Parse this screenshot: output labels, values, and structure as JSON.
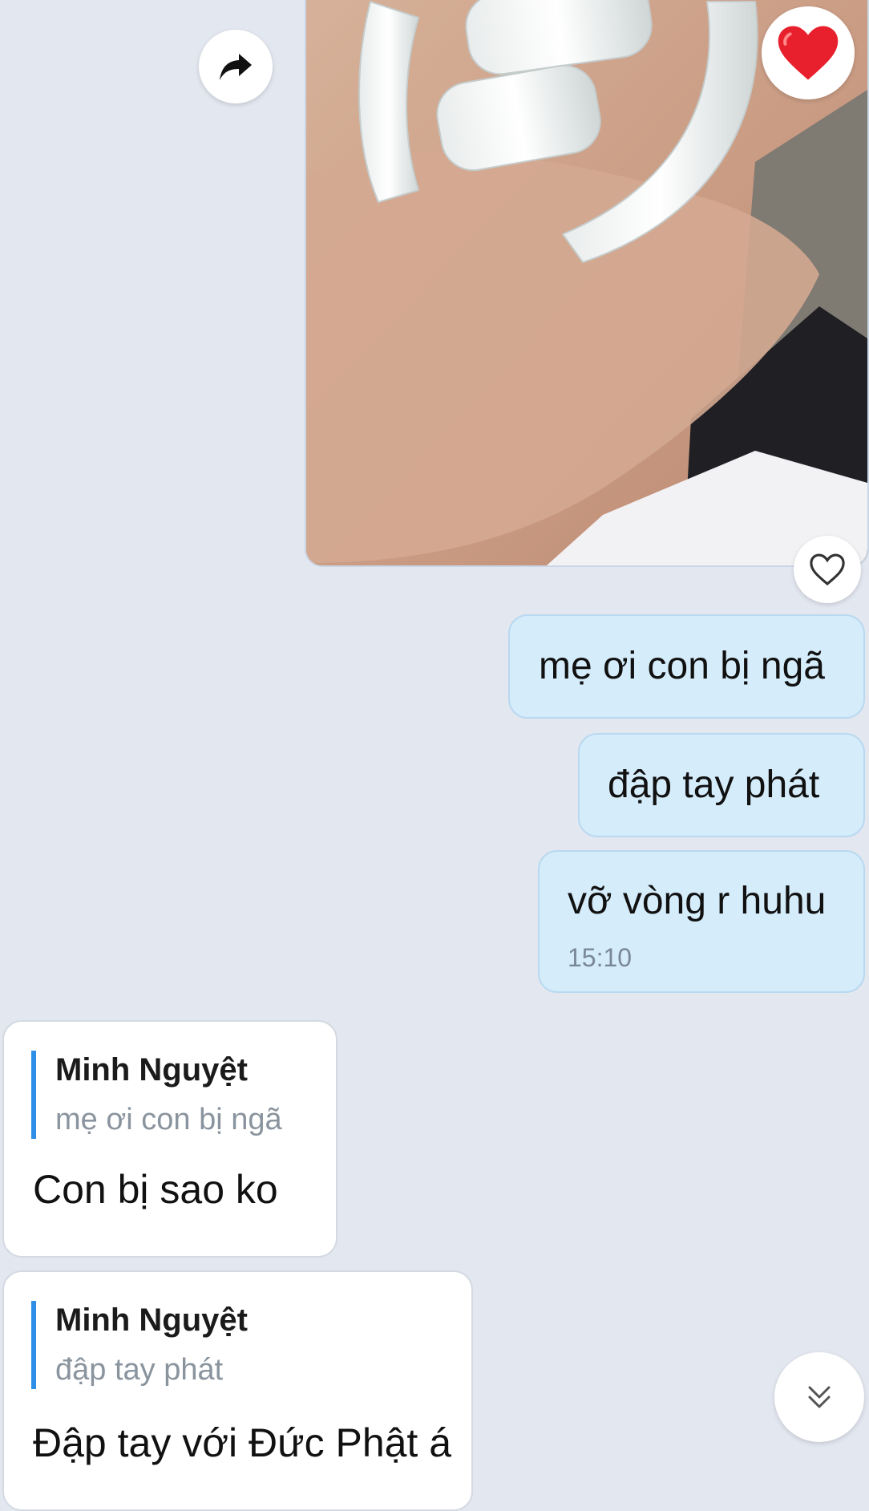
{
  "photo": {
    "reaction": "heart-icon"
  },
  "outgoing": [
    {
      "text": "mẹ ơi con bị ngã"
    },
    {
      "text": "đập tay phát"
    },
    {
      "text": "vỡ vòng r huhu",
      "time": "15:10"
    }
  ],
  "incoming": [
    {
      "quote_author": "Minh Nguyệt",
      "quote_text": "mẹ ơi con bị ngã",
      "text": "Con bị sao ko"
    },
    {
      "quote_author": "Minh Nguyệt",
      "quote_text": "đập tay phát",
      "text": "Đập tay với Đức Phật á"
    }
  ],
  "colors": {
    "background": "#e3e7f0",
    "outgoing_bubble": "#d5ecfb",
    "quote_bar": "#2f8fe8",
    "reaction": "#e8202e"
  },
  "icons": [
    "share-icon",
    "heart-icon",
    "heart-outline-icon",
    "chevron-double-down-icon"
  ]
}
